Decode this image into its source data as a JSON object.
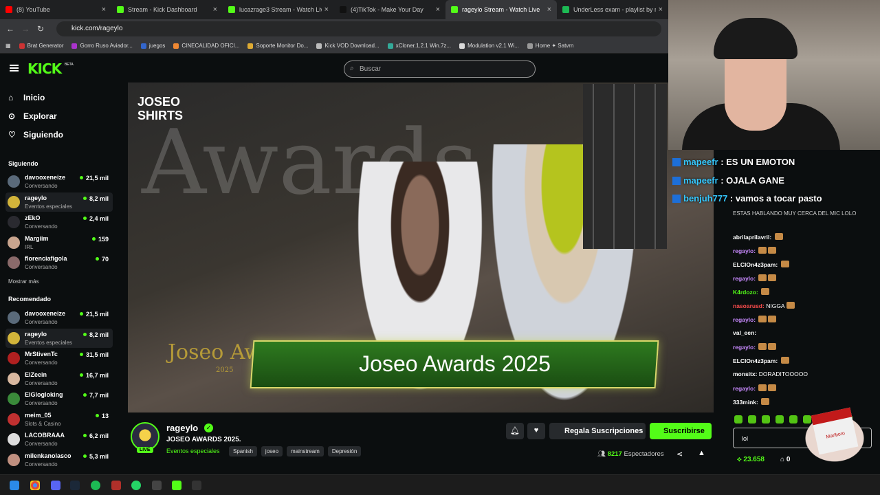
{
  "browser": {
    "tabs": [
      {
        "title": "(8) YouTube",
        "color": "#ff0000"
      },
      {
        "title": "Stream - Kick Dashboard",
        "color": "#53fc18"
      },
      {
        "title": "lucazrage3 Stream - Watch Live",
        "color": "#53fc18"
      },
      {
        "title": "(4)TikTok - Make Your Day",
        "color": "#111111"
      },
      {
        "title": "rageylo Stream - Watch Live",
        "color": "#53fc18"
      },
      {
        "title": "UnderLess exam - playlist by m",
        "color": "#1db954"
      }
    ],
    "url": "kick.com/rageylo",
    "bookmarks": [
      "Brat Generator",
      "Gorro Ruso Aviador...",
      "juegos",
      "CINECALIDAD OFICI...",
      "Soporte Monitor Do...",
      "Kick VOD Download...",
      "xCloner.1.2.1 Win.7z...",
      "Modulation v2.1 Wi...",
      "Home ✦ Satvrn"
    ]
  },
  "header": {
    "logo": "KICK",
    "beta": "BETA",
    "search_placeholder": "Buscar"
  },
  "nav": [
    {
      "label": "Inicio",
      "icon": "home-icon"
    },
    {
      "label": "Explorar",
      "icon": "compass-icon"
    },
    {
      "label": "Siguiendo",
      "icon": "heart-icon"
    }
  ],
  "following_title": "Siguiendo",
  "following": [
    {
      "name": "davooxeneize",
      "cat": "Conversando",
      "viewers": "21,5 mil",
      "color": "#5a6a7a"
    },
    {
      "name": "rageylo",
      "cat": "Eventos especiales",
      "viewers": "8,2 mil",
      "color": "#d2b43a"
    },
    {
      "name": "zEkO",
      "cat": "Conversando",
      "viewers": "2,4 mil",
      "color": "#2a2a30"
    },
    {
      "name": "Margiim",
      "cat": "IRL",
      "viewers": "159",
      "color": "#c9a58e"
    },
    {
      "name": "florenciafigola",
      "cat": "Conversando",
      "viewers": "70",
      "color": "#8a6a6a"
    }
  ],
  "show_more": "Mostrar más",
  "recommended_title": "Recomendado",
  "recommended": [
    {
      "name": "davooxeneize",
      "cat": "Conversando",
      "viewers": "21,5 mil",
      "color": "#5a6a7a"
    },
    {
      "name": "rageylo",
      "cat": "Eventos especiales",
      "viewers": "8,2 mil",
      "color": "#d2b43a"
    },
    {
      "name": "MrStivenTc",
      "cat": "Conversando",
      "viewers": "31,5 mil",
      "color": "#b02020"
    },
    {
      "name": "ElZeein",
      "cat": "Conversando",
      "viewers": "16,7 mil",
      "color": "#d8b8a0"
    },
    {
      "name": "ElGlogloking",
      "cat": "Conversando",
      "viewers": "7,7 mil",
      "color": "#3a8a3a"
    },
    {
      "name": "meim_05",
      "cat": "Slots & Casino",
      "viewers": "13",
      "color": "#c03030"
    },
    {
      "name": "LACOBRAAA",
      "cat": "Conversando",
      "viewers": "6,2 mil",
      "color": "#ddd"
    },
    {
      "name": "milenkanolasco",
      "cat": "Conversando",
      "viewers": "5,3 mil",
      "color": "#c09080"
    }
  ],
  "video": {
    "watermark": "JOSEO SHIRTS",
    "banner": "Joseo Awards 2025",
    "bg_text": "Awards",
    "logo_text": "Joseo Awards",
    "logo_year": "2025"
  },
  "overlay_chat": [
    {
      "user": "mapeefr",
      "text": "ES UN EMOTON"
    },
    {
      "user": "mapeefr",
      "text": "OJALA GANE"
    },
    {
      "user": "benjuh777",
      "text": "vamos a tocar pasto"
    }
  ],
  "chat": [
    {
      "user": "abrilaprilavril:",
      "text": "",
      "color": "#ffffff",
      "emotes": 1
    },
    {
      "user": "regaylo:",
      "text": "",
      "color": "#c98aff",
      "emotes": 2
    },
    {
      "user": "ELCIOn4z3pam:",
      "text": "",
      "color": "#ffffff",
      "emotes": 1
    },
    {
      "user": "regaylo:",
      "text": "",
      "color": "#c98aff",
      "emotes": 2
    },
    {
      "user": "K4rdozo:",
      "text": "",
      "color": "#53fc18",
      "emotes": 1
    },
    {
      "user": "nasoarusd:",
      "text": "NIGGA",
      "color": "#ff4d4d",
      "emotes": 1
    },
    {
      "user": "regaylo:",
      "text": "",
      "color": "#c98aff",
      "emotes": 2
    },
    {
      "user": "val_een:",
      "text": "",
      "color": "#ffffff",
      "emotes": 0
    },
    {
      "user": "regaylo:",
      "text": "",
      "color": "#c98aff",
      "emotes": 2
    },
    {
      "user": "ELCIOn4z3pam:",
      "text": "",
      "color": "#ffffff",
      "emotes": 1
    },
    {
      "user": "monsitx:",
      "text": "DORADITOOOOO",
      "color": "#ffffff",
      "emotes": 0
    },
    {
      "user": "regaylo:",
      "text": "",
      "color": "#c98aff",
      "emotes": 2
    },
    {
      "user": "333mink:",
      "text": "",
      "color": "#ffffff",
      "emotes": 1
    }
  ],
  "chat_top_snip": "ESTAS HABLANDO MUY CERCA DEL MIC LOLO",
  "channel": {
    "name": "rageylo",
    "title": "JOSEO AWARDS 2025.",
    "category": "Eventos especiales",
    "tags": [
      "Spanish",
      "joseo",
      "mainstream",
      "Depresión"
    ],
    "live": "LIVE",
    "gift_label": "Regala Suscripciones",
    "subscribe_label": "Suscribirse",
    "viewers": "8217",
    "viewers_label": "Espectadores"
  },
  "chat_input": {
    "value": "lol"
  },
  "points": "23.658",
  "other_count": "0",
  "pack_text": "Marlboro",
  "colors": {
    "accent": "#53fc18",
    "bg": "#0b0e0f"
  }
}
